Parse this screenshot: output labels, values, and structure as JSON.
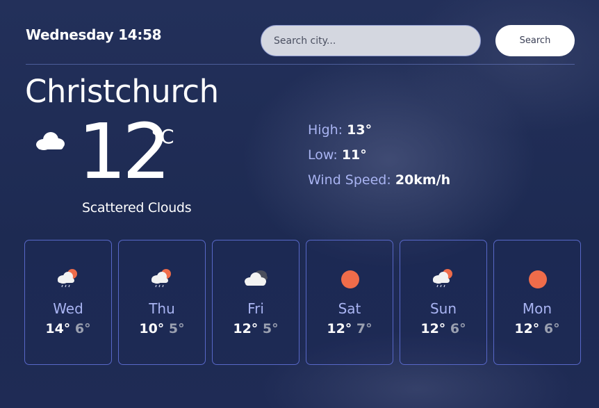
{
  "header": {
    "datetime": "Wednesday 14:58",
    "search_placeholder": "Search city...",
    "search_button_label": "Search"
  },
  "current": {
    "city": "Christchurch",
    "temperature": "12",
    "unit": "°C",
    "condition": "Scattered Clouds",
    "icon": "cloud-icon",
    "details": [
      {
        "label": "High:",
        "value": "13°"
      },
      {
        "label": "Low:",
        "value": "11°"
      },
      {
        "label": "Wind Speed:",
        "value": "20km/h"
      }
    ]
  },
  "forecast": [
    {
      "day": "Wed",
      "high": "14°",
      "low": "6°",
      "icon": "rain-sun-icon"
    },
    {
      "day": "Thu",
      "high": "10°",
      "low": "5°",
      "icon": "rain-sun-icon"
    },
    {
      "day": "Fri",
      "high": "12°",
      "low": "5°",
      "icon": "broken-clouds-icon"
    },
    {
      "day": "Sat",
      "high": "12°",
      "low": "7°",
      "icon": "sun-icon"
    },
    {
      "day": "Sun",
      "high": "12°",
      "low": "6°",
      "icon": "rain-sun-icon"
    },
    {
      "day": "Mon",
      "high": "12°",
      "low": "6°",
      "icon": "sun-icon"
    }
  ],
  "colors": {
    "accent_label": "#a9b4f2",
    "card_border": "#5868c8",
    "sun": "#ef6c4a",
    "low_temp": "#9aa0b0"
  }
}
